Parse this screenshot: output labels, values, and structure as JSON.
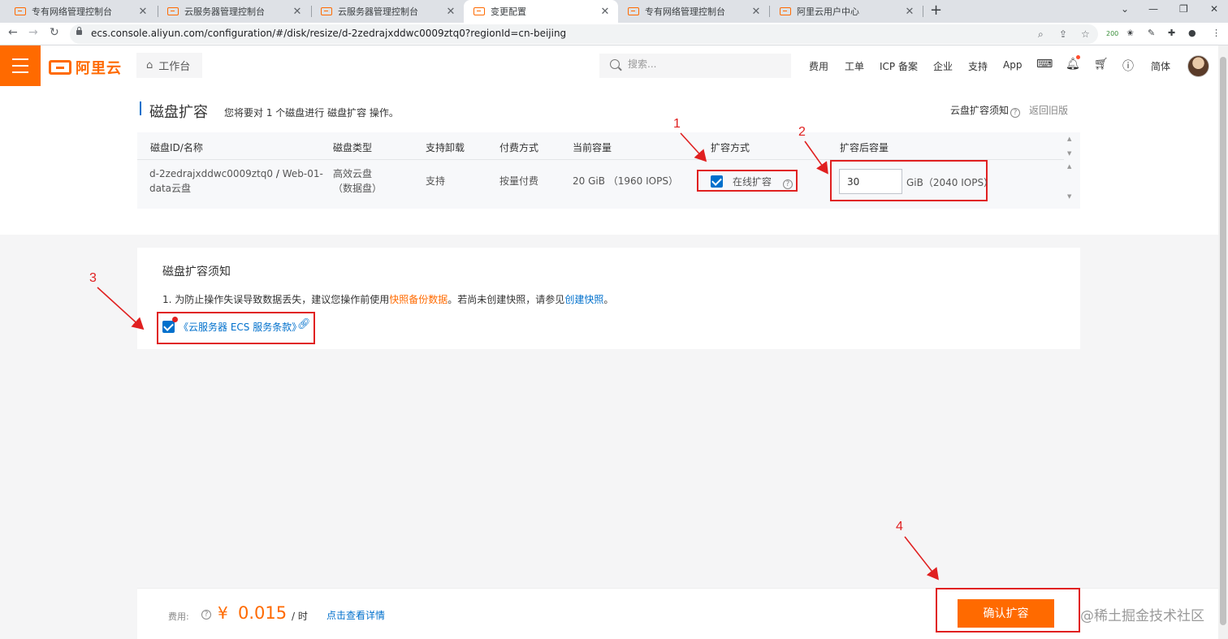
{
  "browser": {
    "tabs": [
      {
        "title": "专有网络管理控制台",
        "active": false
      },
      {
        "title": "云服务器管理控制台",
        "active": false
      },
      {
        "title": "云服务器管理控制台",
        "active": false
      },
      {
        "title": "变更配置",
        "active": true
      },
      {
        "title": "专有网络管理控制台",
        "active": false
      },
      {
        "title": "阿里云用户中心",
        "active": false
      }
    ],
    "url": "ecs.console.aliyun.com/configuration/#/disk/resize/d-2zedrajxddwc0009ztq0?regionId=cn-beijing",
    "extension_badge": "200"
  },
  "header": {
    "logo_text": "阿里云",
    "workbench_label": "工作台",
    "search_placeholder": "搜索...",
    "nav": [
      "费用",
      "工单",
      "ICP 备案",
      "企业",
      "支持",
      "App"
    ],
    "language": "简体"
  },
  "page": {
    "title": "磁盘扩容",
    "subtitle": "您将要对 1 个磁盘进行 磁盘扩容 操作。",
    "notice_link": "云盘扩容须知",
    "return_link": "返回旧版"
  },
  "table": {
    "headers": [
      "磁盘ID/名称",
      "磁盘类型",
      "支持卸载",
      "付费方式",
      "当前容量",
      "扩容方式",
      "扩容后容量"
    ],
    "row": {
      "disk_id": "d-2zedrajxddwc0009ztq0",
      "separator": "/",
      "disk_name_1": "Web-01-",
      "disk_name_2": "data云盘",
      "type_1": "高效云盘",
      "type_2": "（数据盘）",
      "detachable": "支持",
      "billing": "按量付费",
      "current_capacity": "20 GiB （1960 IOPS）",
      "resize_mode": "在线扩容",
      "resize_mode_checked": true,
      "new_capacity": "30",
      "new_capacity_unit": "GiB（2040 IOPS）"
    }
  },
  "notice": {
    "title": "磁盘扩容须知",
    "text_prefix": "1. 为防止操作失误导致数据丢失，建议您操作前使用",
    "snapshot_backup_link": "快照备份数据",
    "text_middle": "。若尚未创建快照，请参见",
    "create_snapshot_link": "创建快照",
    "text_suffix": "。",
    "agreement_label": "《云服务器 ECS 服务条款》",
    "agreement_checked": true
  },
  "annotations": [
    "1",
    "2",
    "3",
    "4"
  ],
  "footer": {
    "fee_label": "费用:",
    "currency": "¥",
    "amount": "0.015",
    "unit": "/ 时",
    "detail_link": "点击查看详情",
    "confirm_button": "确认扩容"
  },
  "watermark": "@稀土掘金技术社区",
  "colors": {
    "brand_orange": "#ff6a00",
    "link_blue": "#0070cc",
    "annotation_red": "#e02020"
  }
}
